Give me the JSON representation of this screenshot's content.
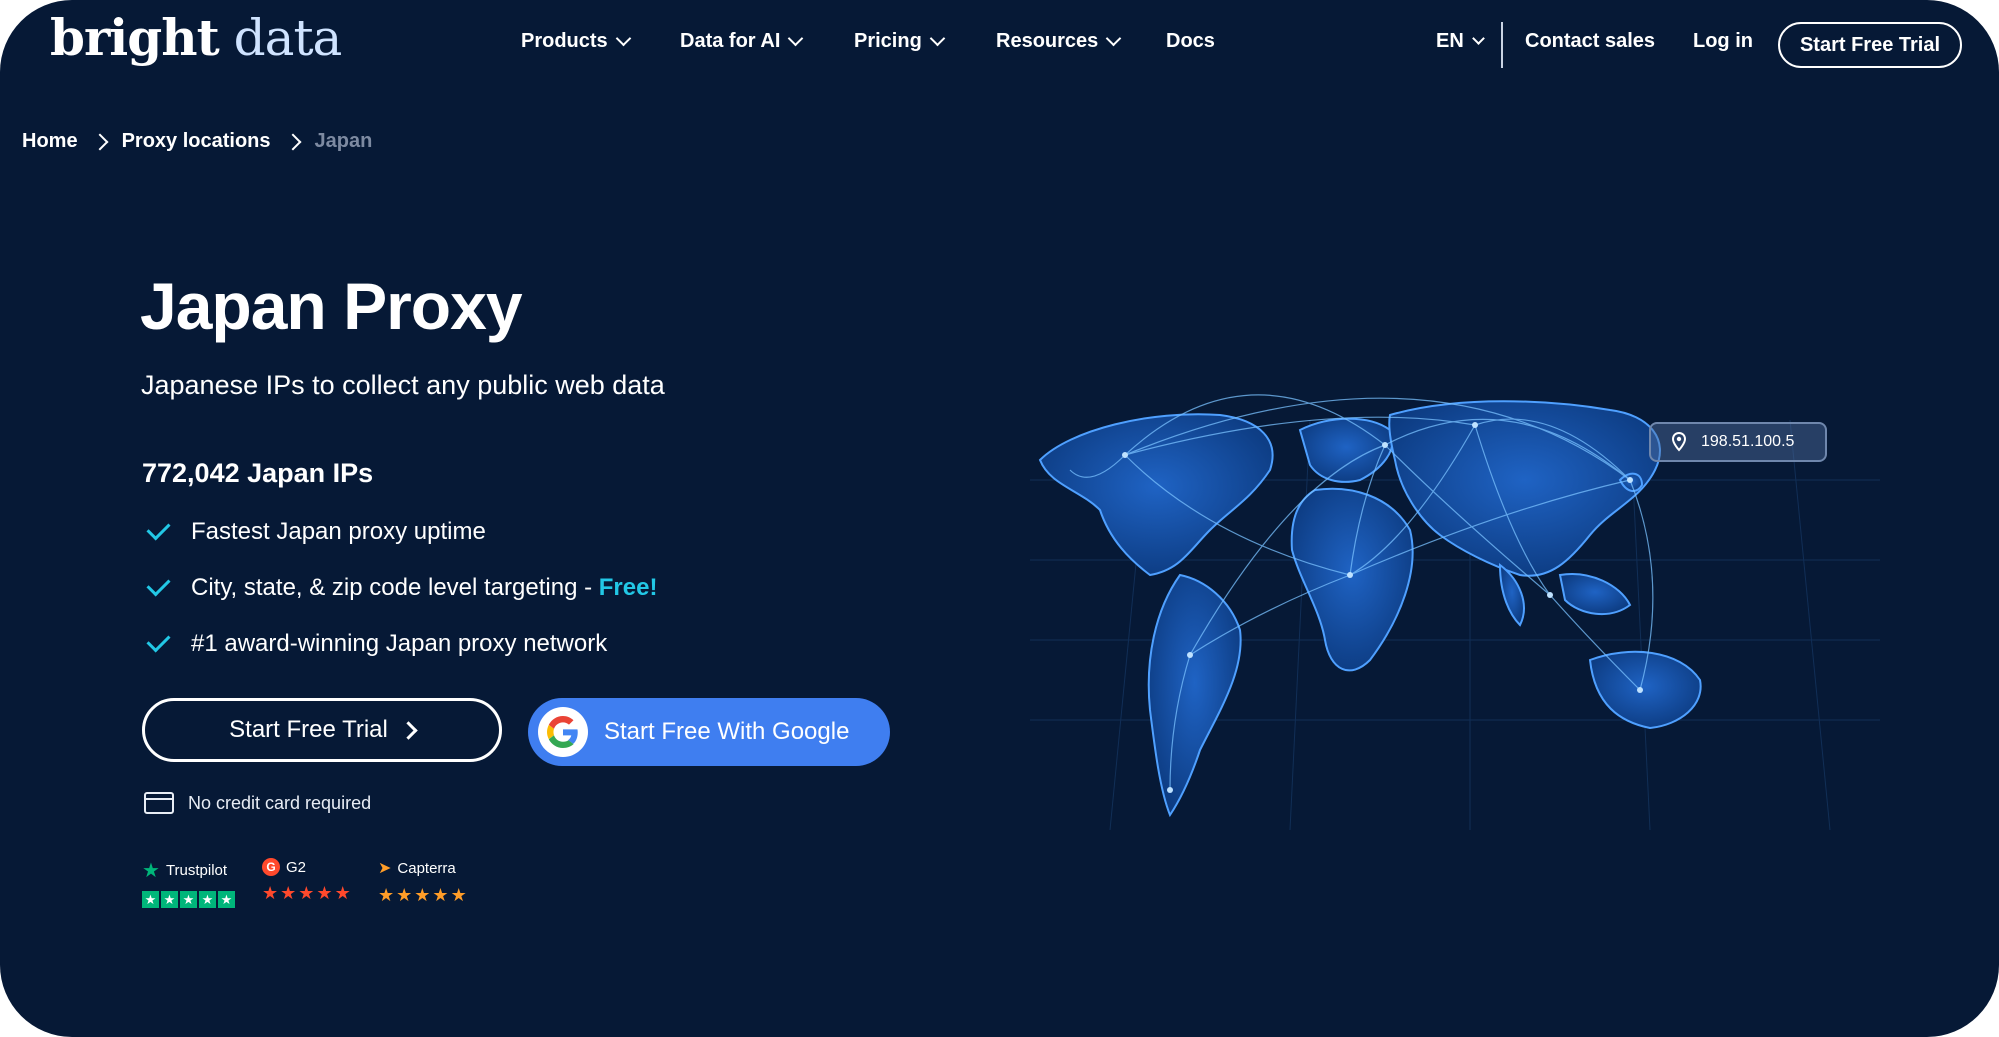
{
  "header": {
    "logo_bold": "bright",
    "logo_light": "data",
    "nav": [
      "Products",
      "Data for AI",
      "Pricing",
      "Resources",
      "Docs"
    ],
    "language": "EN",
    "contact_sales": "Contact sales",
    "login": "Log in",
    "start_trial": "Start Free Trial"
  },
  "breadcrumb": {
    "home": "Home",
    "locations": "Proxy locations",
    "current": "Japan"
  },
  "hero": {
    "title": "Japan Proxy",
    "subtitle": "Japanese IPs to collect any public web data",
    "ip_count": "772,042 Japan IPs",
    "features": [
      "Fastest Japan proxy uptime",
      "City, state, & zip code level targeting - ",
      "#1 award-winning Japan proxy network"
    ],
    "free_highlight": "Free!",
    "trial_button": "Start Free Trial",
    "google_button": "Start Free With Google",
    "no_credit_card": "No credit card required"
  },
  "reviews": {
    "trustpilot": "Trustpilot",
    "g2": "G2",
    "capterra": "Capterra"
  },
  "map": {
    "ip_tag": "198.51.100.5"
  },
  "colors": {
    "background": "#061936",
    "accent": "#22c8e6",
    "google_button": "#3f7ef0"
  }
}
